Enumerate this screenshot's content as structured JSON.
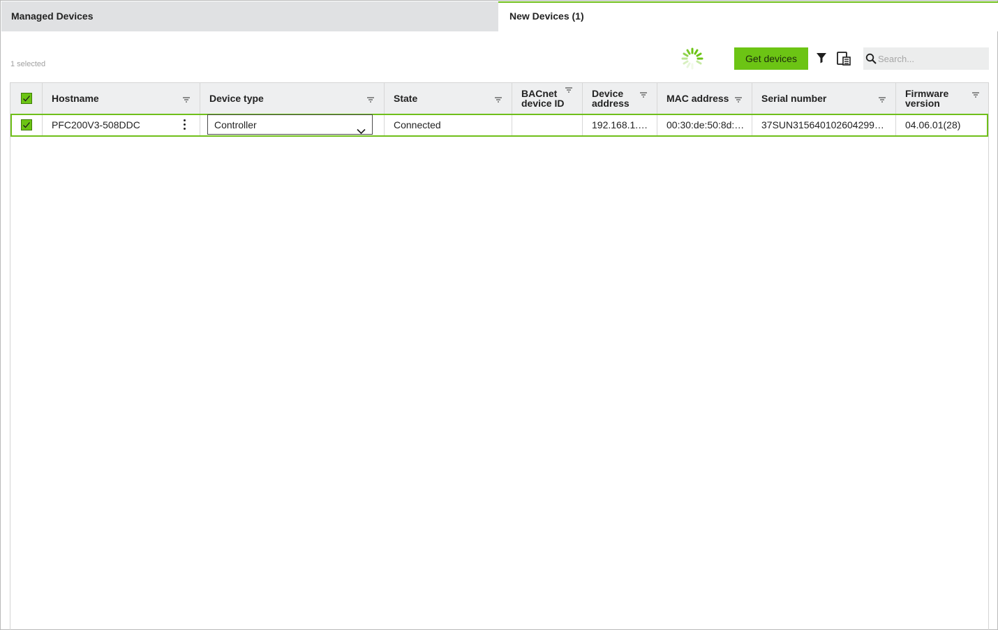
{
  "tabs": {
    "managed": "Managed Devices",
    "new": "New Devices (1)"
  },
  "selection": {
    "count_text": "1 selected"
  },
  "toolbar": {
    "get_devices_label": "Get devices",
    "search_placeholder": "Search..."
  },
  "icons": {
    "spinner": "loading-spinner-icon",
    "filter": "filter-funnel-icon",
    "columns": "column-settings-icon",
    "search": "search-icon",
    "sort": "sort-filter-icon",
    "kebab": "more-options-icon",
    "chevron": "chevron-down-icon"
  },
  "colors": {
    "accent": "#6cc414",
    "row_outline": "#6fbf1a",
    "tab_inactive_bg": "#e0e1e3",
    "header_bg": "#eeeff0"
  },
  "table": {
    "columns": [
      {
        "key": "hostname",
        "label": "Hostname"
      },
      {
        "key": "device_type",
        "label": "Device type"
      },
      {
        "key": "state",
        "label": "State"
      },
      {
        "key": "bacnet_id",
        "label": "BACnet device ID"
      },
      {
        "key": "device_address",
        "label": "Device address"
      },
      {
        "key": "mac",
        "label": "MAC address"
      },
      {
        "key": "serial",
        "label": "Serial number"
      },
      {
        "key": "firmware",
        "label": "Firmware version"
      }
    ],
    "header_checked": true,
    "rows": [
      {
        "checked": true,
        "hostname": "PFC200V3-508DDC",
        "device_type": "Controller",
        "state": "Connected",
        "bacnet_id": "",
        "device_address": "192.168.1.…",
        "mac": "00:30:de:50:8d:…",
        "serial": "37SUN315640102604299…",
        "firmware": "04.06.01(28)"
      }
    ]
  }
}
